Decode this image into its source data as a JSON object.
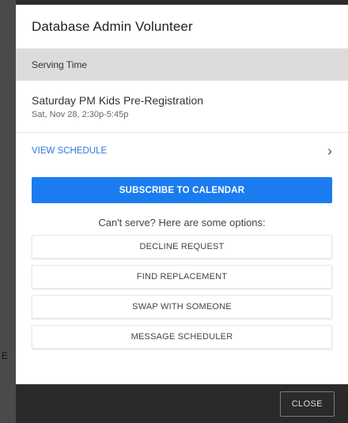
{
  "modal": {
    "title": "Database Admin Volunteer",
    "section_label": "Serving Time",
    "event": {
      "name": "Saturday PM Kids Pre-Registration",
      "time": "Sat, Nov 28, 2:30p-5:45p"
    },
    "view_schedule_label": "VIEW SCHEDULE",
    "subscribe_label": "SUBSCRIBE TO CALENDAR",
    "options_heading": "Can't serve? Here are some options:",
    "options": [
      "DECLINE REQUEST",
      "FIND REPLACEMENT",
      "SWAP WITH SOMEONE",
      "MESSAGE SCHEDULER"
    ],
    "close_label": "CLOSE"
  },
  "backdrop": {
    "glyph": "E"
  },
  "icons": {
    "view_schedule_chevron": "chevron-right-icon"
  },
  "colors": {
    "primary": "#1b7cf0",
    "link": "#2f7ad8",
    "footer": "#2a2a2a",
    "section_bar": "#dcdcdc"
  }
}
